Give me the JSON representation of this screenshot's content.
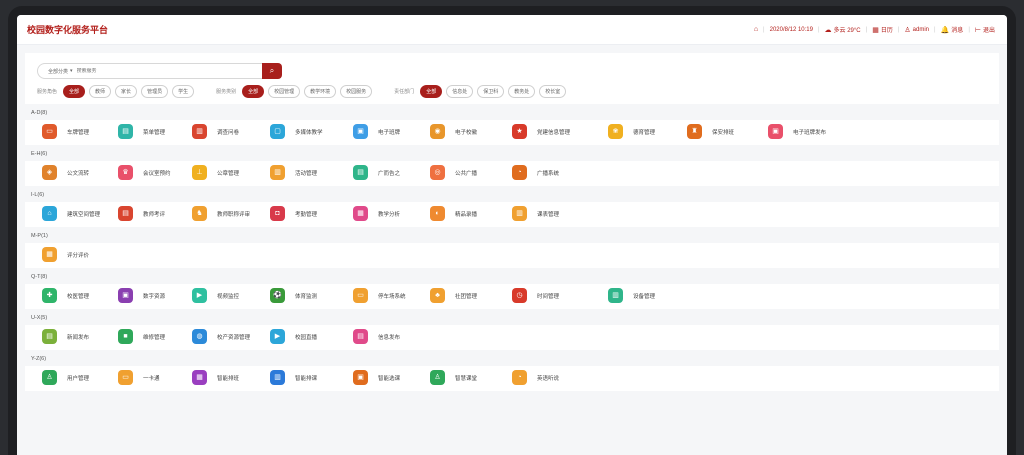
{
  "app_title": "校园数字化服务平台",
  "topbar": {
    "items": [
      {
        "icon": "home-icon",
        "glyph": "⌂",
        "label": ""
      },
      {
        "icon": "",
        "glyph": "",
        "label": "2020/8/12 10:19"
      },
      {
        "icon": "weather-icon",
        "glyph": "☁",
        "label": "多云 29°C"
      },
      {
        "icon": "calendar-icon",
        "glyph": "▦",
        "label": "日历"
      },
      {
        "icon": "user-icon",
        "glyph": "♙",
        "label": "admin"
      },
      {
        "icon": "bell-icon",
        "glyph": "🔔",
        "label": "消息"
      },
      {
        "icon": "logout-icon",
        "glyph": "⊢",
        "label": "退出"
      }
    ]
  },
  "search": {
    "scope": "全部分类",
    "placeholder": "搜索服务",
    "button_icon": "search-icon"
  },
  "filters": [
    {
      "label": "服务角色",
      "options": [
        "全部",
        "教师",
        "家长",
        "管理员",
        "学生"
      ],
      "active": 0
    },
    {
      "label": "服务类别",
      "options": [
        "全部",
        "校园管理",
        "教学环境",
        "校园服务"
      ],
      "active": 0
    },
    {
      "label": "责任部门",
      "options": [
        "全部",
        "信息处",
        "保卫科",
        "教务处",
        "校长室"
      ],
      "active": 0
    }
  ],
  "sections": [
    {
      "title": "A-D(8)",
      "items": [
        {
          "label": "车牌管理",
          "color": "#e05a2b",
          "glyph": "▭"
        },
        {
          "label": "菜单管理",
          "color": "#2fb5a8",
          "glyph": "▤"
        },
        {
          "label": "调查问卷",
          "color": "#d9452f",
          "glyph": "▥"
        },
        {
          "label": "多媒体教学",
          "color": "#2ca6d9",
          "glyph": "▢"
        },
        {
          "label": "电子班牌",
          "color": "#3f9ee6",
          "glyph": "▣"
        },
        {
          "label": "电子校徽",
          "color": "#e8962b",
          "glyph": "◉"
        },
        {
          "label": "党建信息管理",
          "color": "#d83a2a",
          "glyph": "★"
        },
        {
          "label": "德育管理",
          "color": "#f0b020",
          "glyph": "❀"
        },
        {
          "label": "保安排班",
          "color": "#e06c1e",
          "glyph": "♜"
        },
        {
          "label": "电子班牌发布",
          "color": "#e9506a",
          "glyph": "▣"
        }
      ]
    },
    {
      "title": "E-H(6)",
      "items": [
        {
          "label": "公文流转",
          "color": "#e0822b",
          "glyph": "◈"
        },
        {
          "label": "会议室预约",
          "color": "#e9506a",
          "glyph": "♛"
        },
        {
          "label": "公章管理",
          "color": "#f0b020",
          "glyph": "⊥"
        },
        {
          "label": "活动管理",
          "color": "#f0a030",
          "glyph": "▥"
        },
        {
          "label": "广而告之",
          "color": "#2fb58a",
          "glyph": "▤"
        },
        {
          "label": "公共广播",
          "color": "#ef7040",
          "glyph": "◎"
        },
        {
          "label": "广播系统",
          "color": "#e06c1e",
          "glyph": "◔"
        }
      ]
    },
    {
      "title": "I-L(6)",
      "items": [
        {
          "label": "建筑空间管理",
          "color": "#2ca6d9",
          "glyph": "⌂"
        },
        {
          "label": "教师考评",
          "color": "#d9452f",
          "glyph": "▤"
        },
        {
          "label": "教师职称评审",
          "color": "#f0a030",
          "glyph": "♞"
        },
        {
          "label": "考勤管理",
          "color": "#d83a4a",
          "glyph": "◘"
        },
        {
          "label": "教学分析",
          "color": "#e04a8a",
          "glyph": "▦"
        },
        {
          "label": "精品录播",
          "color": "#ef8a30",
          "glyph": "◐"
        },
        {
          "label": "课表管理",
          "color": "#f0a030",
          "glyph": "▥"
        }
      ]
    },
    {
      "title": "M-P(1)",
      "items": [
        {
          "label": "评分评价",
          "color": "#f0a030",
          "glyph": "▦"
        }
      ]
    },
    {
      "title": "Q-T(8)",
      "items": [
        {
          "label": "校医管理",
          "color": "#2fb56a",
          "glyph": "✚"
        },
        {
          "label": "数字资源",
          "color": "#8a3fb0",
          "glyph": "▣"
        },
        {
          "label": "视频监控",
          "color": "#2fc0a0",
          "glyph": "▶"
        },
        {
          "label": "体育监测",
          "color": "#3a9a3a",
          "glyph": "⚽"
        },
        {
          "label": "停车场系统",
          "color": "#f0a030",
          "glyph": "▭"
        },
        {
          "label": "社团管理",
          "color": "#f0a030",
          "glyph": "♣"
        },
        {
          "label": "时间管理",
          "color": "#d83a2a",
          "glyph": "◷"
        },
        {
          "label": "设备管理",
          "color": "#2fb58a",
          "glyph": "▥"
        }
      ]
    },
    {
      "title": "U-X(5)",
      "items": [
        {
          "label": "新闻发布",
          "color": "#7bb03a",
          "glyph": "▤"
        },
        {
          "label": "维修管理",
          "color": "#2fa85a",
          "glyph": "■"
        },
        {
          "label": "校产资源管理",
          "color": "#2c8ad9",
          "glyph": "◍"
        },
        {
          "label": "校园直播",
          "color": "#2ca6d9",
          "glyph": "▶"
        },
        {
          "label": "信息发布",
          "color": "#e04a8a",
          "glyph": "▤"
        }
      ]
    },
    {
      "title": "Y-Z(6)",
      "items": [
        {
          "label": "用户管理",
          "color": "#2fa85a",
          "glyph": "♙"
        },
        {
          "label": "一卡通",
          "color": "#f0a030",
          "glyph": "▭"
        },
        {
          "label": "智能排班",
          "color": "#9a3fc0",
          "glyph": "▦"
        },
        {
          "label": "智能排课",
          "color": "#2c7ad9",
          "glyph": "▥"
        },
        {
          "label": "智能选课",
          "color": "#e06c1e",
          "glyph": "▣"
        },
        {
          "label": "智慧课堂",
          "color": "#2fa85a",
          "glyph": "♙"
        },
        {
          "label": "英语听说",
          "color": "#f0a030",
          "glyph": "◔"
        }
      ]
    }
  ]
}
